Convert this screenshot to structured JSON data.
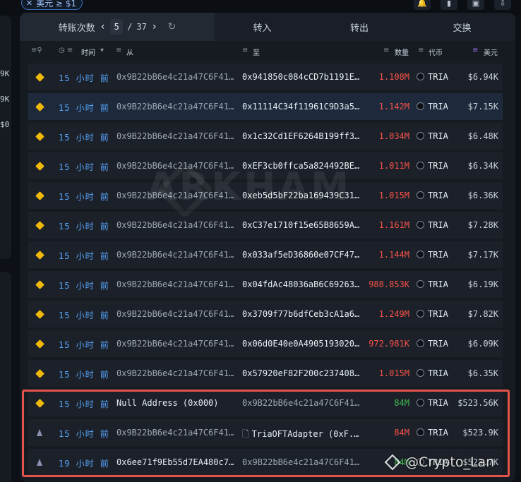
{
  "filter_chip": {
    "label": "美元 ≥ $1"
  },
  "left_values": [
    "9K",
    "9K",
    "$0"
  ],
  "tabs": {
    "transfers": "转账次数",
    "page_current": "5",
    "page_sep": "/",
    "page_total": "37",
    "inflow": "转入",
    "outflow": "转出",
    "swaps": "交换"
  },
  "columns": {
    "time": "时间",
    "from": "从",
    "to": "至",
    "amount": "数量",
    "token": "代币",
    "usd": "美元"
  },
  "rows": [
    {
      "chain": "bnb",
      "time": "15 小时 前",
      "from": "0x9B22bB6e4c21a47C6F41...",
      "to": "0x941850c084cCD7b1191E...",
      "amount": "1.108M",
      "token": "TRIA",
      "usd": "$6.94K"
    },
    {
      "chain": "bnb",
      "time": "15 小时 前",
      "from": "0x9B22bB6e4c21a47C6F41...",
      "to": "0x11114C34f11961C9D3a5...",
      "amount": "1.142M",
      "token": "TRIA",
      "usd": "$7.15K"
    },
    {
      "chain": "bnb",
      "time": "15 小时 前",
      "from": "0x9B22bB6e4c21a47C6F41...",
      "to": "0x1c32Cd1EF6264B199ff3...",
      "amount": "1.034M",
      "token": "TRIA",
      "usd": "$6.48K"
    },
    {
      "chain": "bnb",
      "time": "15 小时 前",
      "from": "0x9B22bB6e4c21a47C6F41...",
      "to": "0xEF3cb0ffca5a824492BE...",
      "amount": "1.011M",
      "token": "TRIA",
      "usd": "$6.34K"
    },
    {
      "chain": "bnb",
      "time": "15 小时 前",
      "from": "0x9B22bB6e4c21a47C6F41...",
      "to": "0xeb5d5bF22ba169439C31...",
      "amount": "1.015M",
      "token": "TRIA",
      "usd": "$6.36K"
    },
    {
      "chain": "bnb",
      "time": "15 小时 前",
      "from": "0x9B22bB6e4c21a47C6F41...",
      "to": "0xC37e1710f15e65B8659A...",
      "amount": "1.161M",
      "token": "TRIA",
      "usd": "$7.28K"
    },
    {
      "chain": "bnb",
      "time": "15 小时 前",
      "from": "0x9B22bB6e4c21a47C6F41...",
      "to": "0x033af5eD36860e07CF47...",
      "amount": "1.144M",
      "token": "TRIA",
      "usd": "$7.17K"
    },
    {
      "chain": "bnb",
      "time": "15 小时 前",
      "from": "0x9B22bB6e4c21a47C6F41...",
      "to": "0x04fdAc48036aB6C69263...",
      "amount": "988.853K",
      "token": "TRIA",
      "usd": "$6.19K"
    },
    {
      "chain": "bnb",
      "time": "15 小时 前",
      "from": "0x9B22bB6e4c21a47C6F41...",
      "to": "0x3709f77b6dfCeb3cA1a6...",
      "amount": "1.249M",
      "token": "TRIA",
      "usd": "$7.82K"
    },
    {
      "chain": "bnb",
      "time": "15 小时 前",
      "from": "0x9B22bB6e4c21a47C6F41...",
      "to": "0x06d0E40e0A4905193020...",
      "amount": "972.981K",
      "token": "TRIA",
      "usd": "$6.09K"
    },
    {
      "chain": "bnb",
      "time": "15 小时 前",
      "from": "0x9B22bB6e4c21a47C6F41...",
      "to": "0x57920eF82F200c237408...",
      "amount": "1.015M",
      "token": "TRIA",
      "usd": "$6.35K"
    },
    {
      "chain": "bnb",
      "time": "15 小时 前",
      "from": "Null Address (0x000)",
      "to": "0x9B22bB6e4c21a47C6F41...",
      "amount": "84M",
      "token": "TRIA",
      "usd": "$523.56K"
    },
    {
      "chain": "eth",
      "time": "15 小时 前",
      "from": "0x9B22bB6e4c21a47C6F41...",
      "to": "TriaOFTAdapter (0xF...",
      "amount": "84M",
      "token": "TRIA",
      "usd": "$523.9K"
    },
    {
      "chain": "eth",
      "time": "19 小时 前",
      "from": "0x6ee71f9Eb55d7EA480c7...",
      "to": "0x9B22bB6e4c21a47C6F41...",
      "amount": "84M",
      "token": "TRIA",
      "usd": "$523.7K"
    }
  ],
  "watermark": "ARKHAM",
  "signature": "@Crypto_Lan",
  "colors": {
    "accent": "#58a6ff",
    "out": "#f85149",
    "in": "#3fb950",
    "highlight_box": "#e5534b"
  }
}
